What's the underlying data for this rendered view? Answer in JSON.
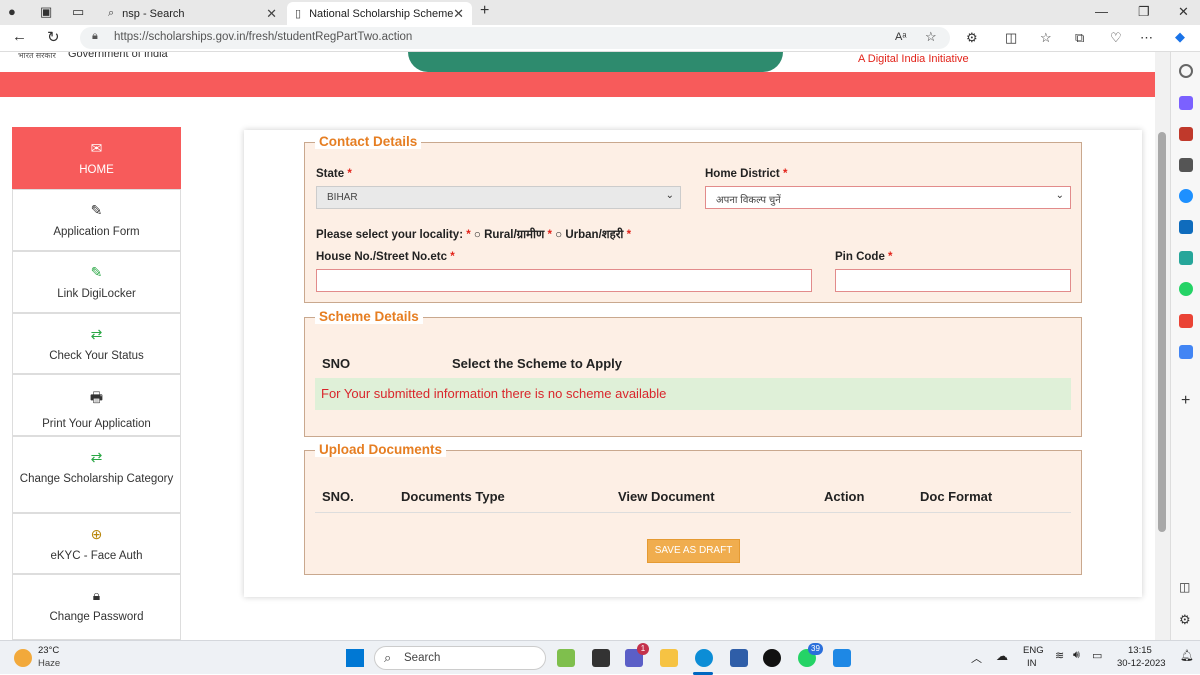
{
  "browser": {
    "tabs": [
      {
        "label": "nsp - Search"
      },
      {
        "label": "National Scholarship Scheme"
      }
    ],
    "new_tab": "+",
    "url": "https://scholarships.gov.in/fresh/studentRegPartTwo.action",
    "reader_label": "Aᴬ"
  },
  "header": {
    "gov_text": "Government of India",
    "digital_india": "A Digital India Initiative"
  },
  "sidebar": {
    "items": [
      {
        "label": "HOME",
        "icon": "envelope-icon"
      },
      {
        "label": "Application Form",
        "icon": "edit-icon"
      },
      {
        "label": "Link DigiLocker",
        "icon": "edit-icon"
      },
      {
        "label": "Check Your Status",
        "icon": "exchange-icon"
      },
      {
        "label": "Print Your Application",
        "icon": "print-icon"
      },
      {
        "label": "Change Scholarship Category",
        "icon": "exchange-icon"
      },
      {
        "label": "eKYC - Face Auth",
        "icon": "download-icon"
      },
      {
        "label": "Change Password",
        "icon": "lock-icon"
      }
    ]
  },
  "contact": {
    "legend": "Contact Details",
    "state_label": "State",
    "state_value": "BIHAR",
    "district_label": "Home District",
    "district_value": "अपना विकल्प चुनें",
    "locality_label": "Please select your locality:",
    "rural": "Rural/ग्रामीण",
    "urban": "Urban/शहरी",
    "house_label": "House No./Street No.etc",
    "pin_label": "Pin Code",
    "required": "*"
  },
  "scheme": {
    "legend": "Scheme Details",
    "col_sno": "SNO",
    "col_select": "Select the Scheme to Apply",
    "empty_msg": "For Your submitted information there is no scheme available"
  },
  "upload": {
    "legend": "Upload Documents",
    "cols": [
      "SNO.",
      "Documents Type",
      "View Document",
      "Action",
      "Doc Format"
    ],
    "draft_button": "SAVE AS DRAFT"
  },
  "taskbar": {
    "weather_temp": "23°C",
    "weather_desc": "Haze",
    "search": "Search",
    "lang1": "ENG",
    "lang2": "IN",
    "time": "13:15",
    "date": "30-12-2023",
    "teams_badge": "1",
    "whatsapp_badge": "39"
  }
}
